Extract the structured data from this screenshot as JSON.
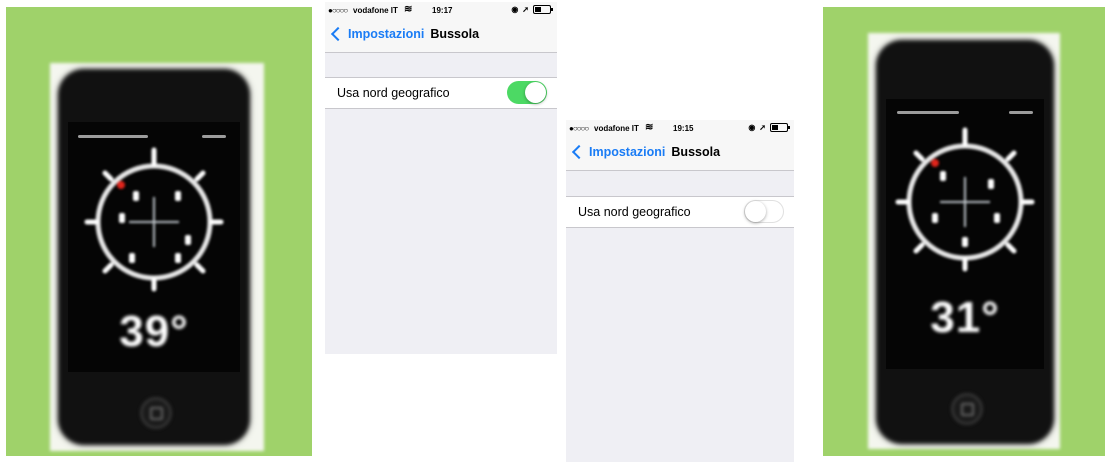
{
  "colors": {
    "photo_background": "#9fd26a",
    "ios_background": "#efeff4",
    "ios_link_blue": "#1a7cf5",
    "toggle_on": "#4cd964",
    "compass_red_marker": "#e0241b"
  },
  "photo_left": {
    "heading": "39°",
    "toggle_state": "geographic north on"
  },
  "screenshot_on": {
    "status": {
      "signal": "●○○○○",
      "carrier": "vodafone IT",
      "wifi_icon": "wifi-icon",
      "time": "19:17"
    },
    "nav": {
      "back_label": "Impostazioni",
      "title": "Bussola"
    },
    "setting": {
      "label": "Usa nord geografico",
      "enabled": true
    }
  },
  "screenshot_off": {
    "status": {
      "signal": "●○○○○",
      "carrier": "vodafone IT",
      "wifi_icon": "wifi-icon",
      "time": "19:15"
    },
    "nav": {
      "back_label": "Impostazioni",
      "title": "Bussola"
    },
    "setting": {
      "label": "Usa nord geografico",
      "enabled": false
    }
  },
  "photo_right": {
    "heading": "31°"
  }
}
